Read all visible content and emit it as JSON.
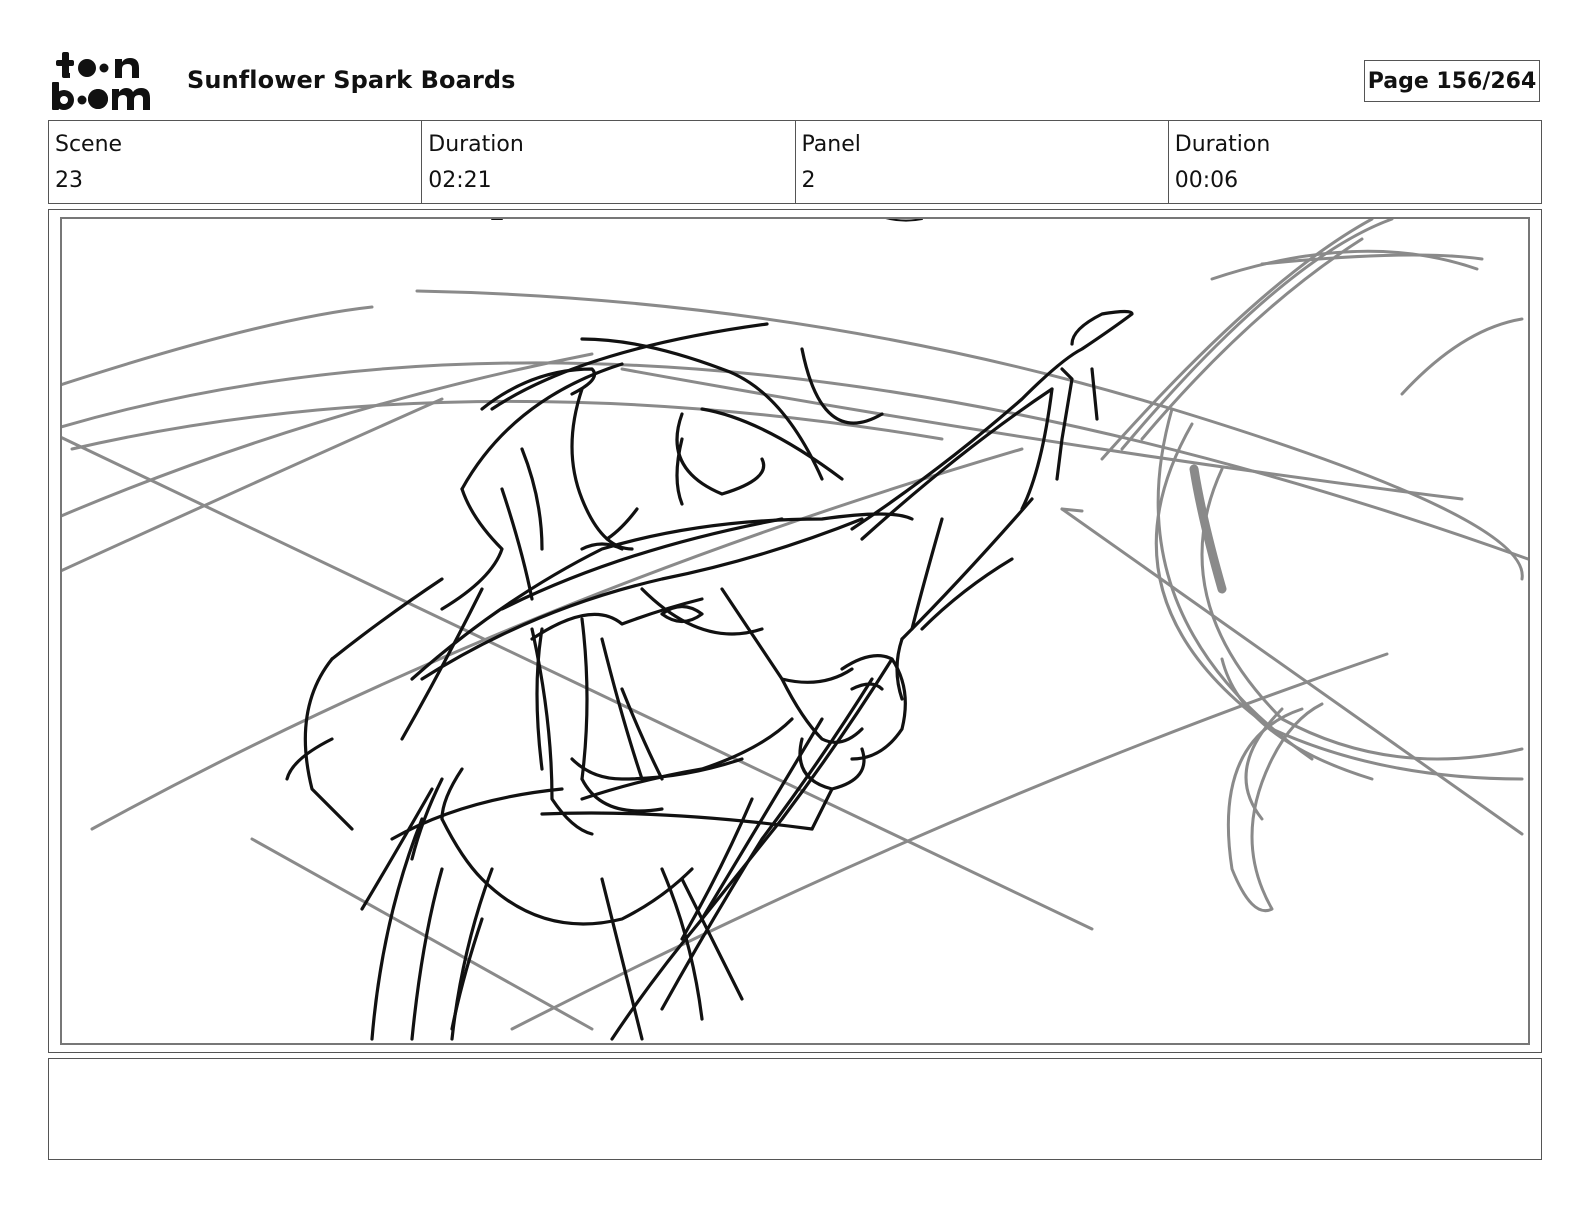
{
  "header": {
    "logo_text": "toonboom",
    "project_title": "Sunflower Spark Boards",
    "page_label": "Page 156/264"
  },
  "info": {
    "scene_label": "Scene",
    "scene_value": "23",
    "scene_duration_label": "Duration",
    "scene_duration_value": "02:21",
    "panel_label": "Panel",
    "panel_value": "2",
    "panel_duration_label": "Duration",
    "panel_duration_value": "00:06"
  },
  "notes": {
    "text": ""
  },
  "colors": {
    "ink": "#111111",
    "construction": "#8a8a8a",
    "border": "#555555"
  }
}
